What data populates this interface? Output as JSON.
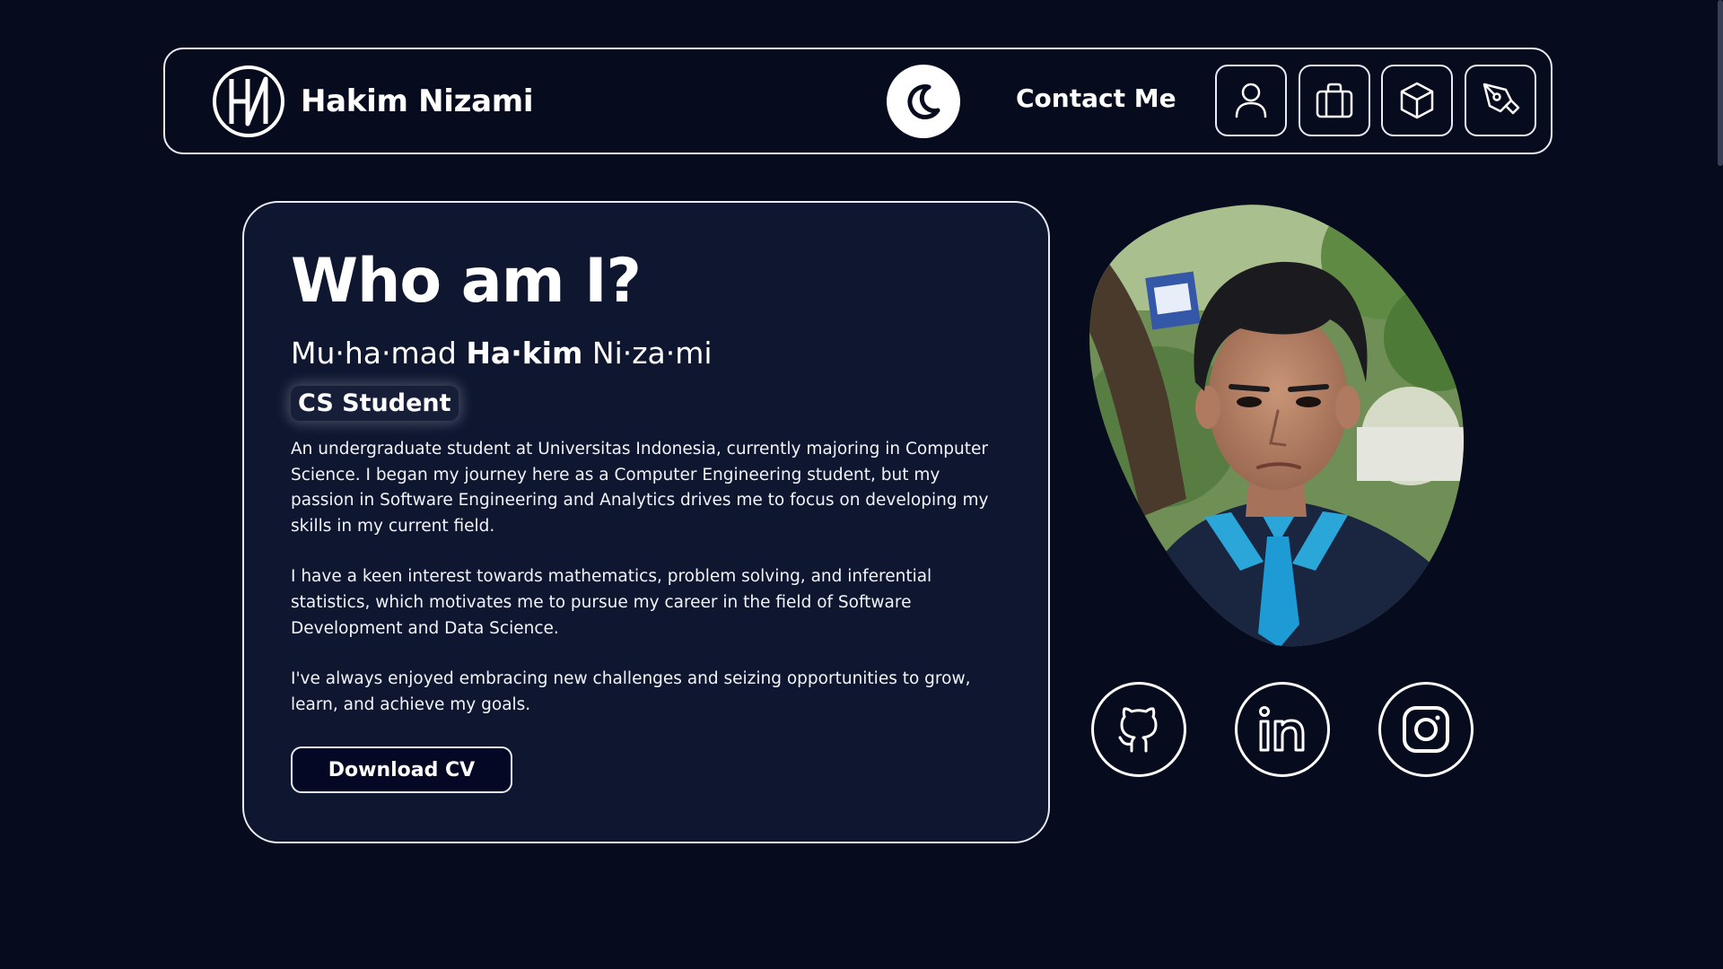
{
  "header": {
    "brand_name": "Hakim Nizami",
    "contact_label": "Contact Me",
    "theme_toggle_icon": "moon-icon",
    "nav_icons": [
      "user-icon",
      "briefcase-icon",
      "box-icon",
      "pen-tool-icon"
    ]
  },
  "about": {
    "title": "Who am I?",
    "name_part1": "Mu·ha·mad ",
    "name_part2": "Ha·kim",
    "name_part3": " Ni·za·mi",
    "role": "CS Student",
    "paragraphs": [
      "An undergraduate student at Universitas Indonesia, currently majoring in Computer Science. I began my journey here as a Computer Engineering student, but my passion in Software Engineering and Analytics drives me to focus on developing my skills in my current field.",
      "I have a keen interest towards mathematics, problem solving, and inferential statistics, which motivates me to pursue my career in the field of Software Development and Data Science.",
      "I've always enjoyed embracing new challenges and seizing opportunities to grow, learn, and achieve my goals."
    ],
    "cv_button": "Download CV"
  },
  "socials": [
    "github-icon",
    "linkedin-icon",
    "instagram-icon"
  ],
  "colors": {
    "background": "#070b1e",
    "card": "#0e1630",
    "border": "#e9ecf5",
    "text": "#ffffff"
  }
}
